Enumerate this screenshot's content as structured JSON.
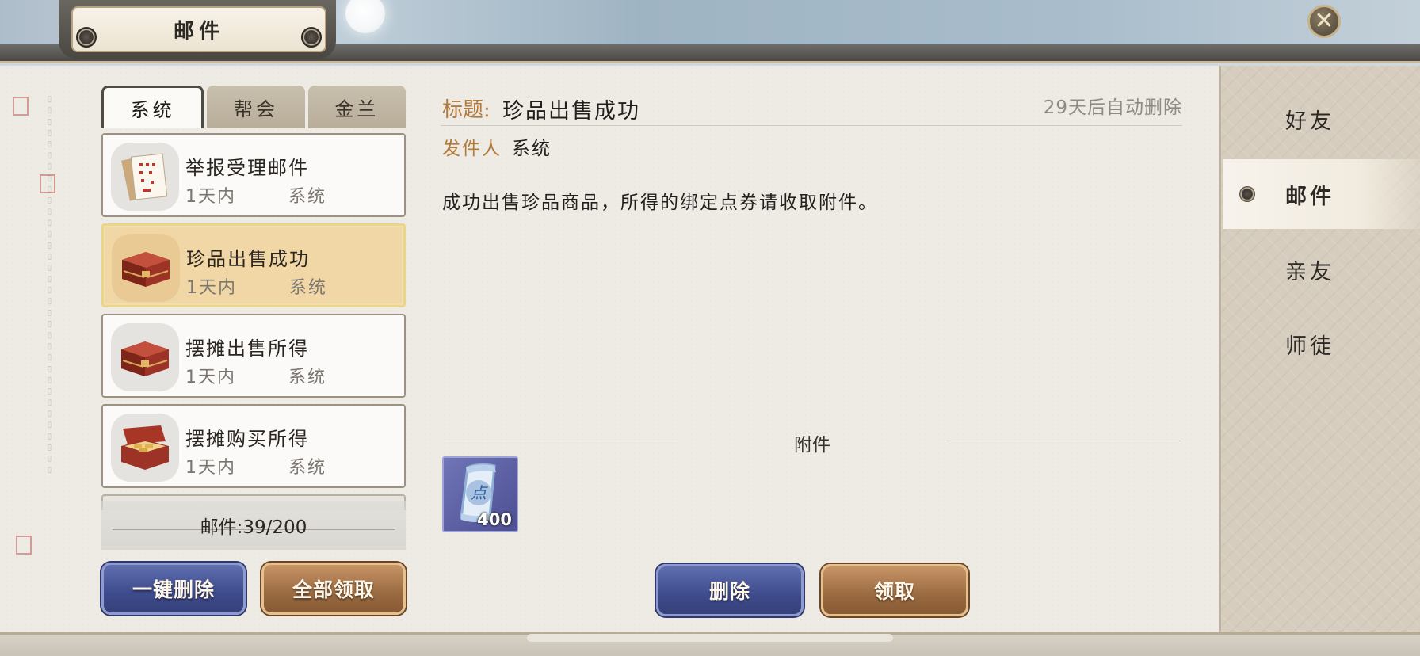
{
  "window": {
    "title": "邮件",
    "close_icon": "close-icon"
  },
  "tabs": [
    {
      "label": "系统",
      "active": true
    },
    {
      "label": "帮会",
      "active": false
    },
    {
      "label": "金兰",
      "active": false
    }
  ],
  "mail_list": [
    {
      "title": "举报受理邮件",
      "time": "1天内",
      "sender": "系统",
      "icon": "document-scroll-icon",
      "selected": false
    },
    {
      "title": "珍品出售成功",
      "time": "1天内",
      "sender": "系统",
      "icon": "treasure-chest-icon",
      "selected": true
    },
    {
      "title": "摆摊出售所得",
      "time": "1天内",
      "sender": "系统",
      "icon": "treasure-chest-icon",
      "selected": false
    },
    {
      "title": "摆摊购买所得",
      "time": "1天内",
      "sender": "系统",
      "icon": "open-chest-gold-icon",
      "selected": false
    }
  ],
  "mail_count": "邮件:39/200",
  "buttons": {
    "delete_all": "一键删除",
    "claim_all": "全部领取",
    "delete": "删除",
    "claim": "领取"
  },
  "mail": {
    "title_label": "标题:",
    "title": "珍品出售成功",
    "auto_delete": "29天后自动删除",
    "sender_label": "发件人",
    "sender": "系统",
    "body": "成功出售珍品商品，所得的绑定点券请收取附件。",
    "attachment_label": "附件",
    "attachment": {
      "icon": "point-voucher-scroll-icon",
      "glyph": "点",
      "count": "400"
    }
  },
  "right_nav": [
    {
      "label": "好友",
      "active": false
    },
    {
      "label": "邮件",
      "active": true
    },
    {
      "label": "亲友",
      "active": false
    },
    {
      "label": "师徒",
      "active": false
    }
  ],
  "colors": {
    "accent_gold": "#b47a3a",
    "selected_item": "#f2d7a6",
    "button_blue": "#3e4b8c",
    "button_brown": "#9a6a40"
  }
}
